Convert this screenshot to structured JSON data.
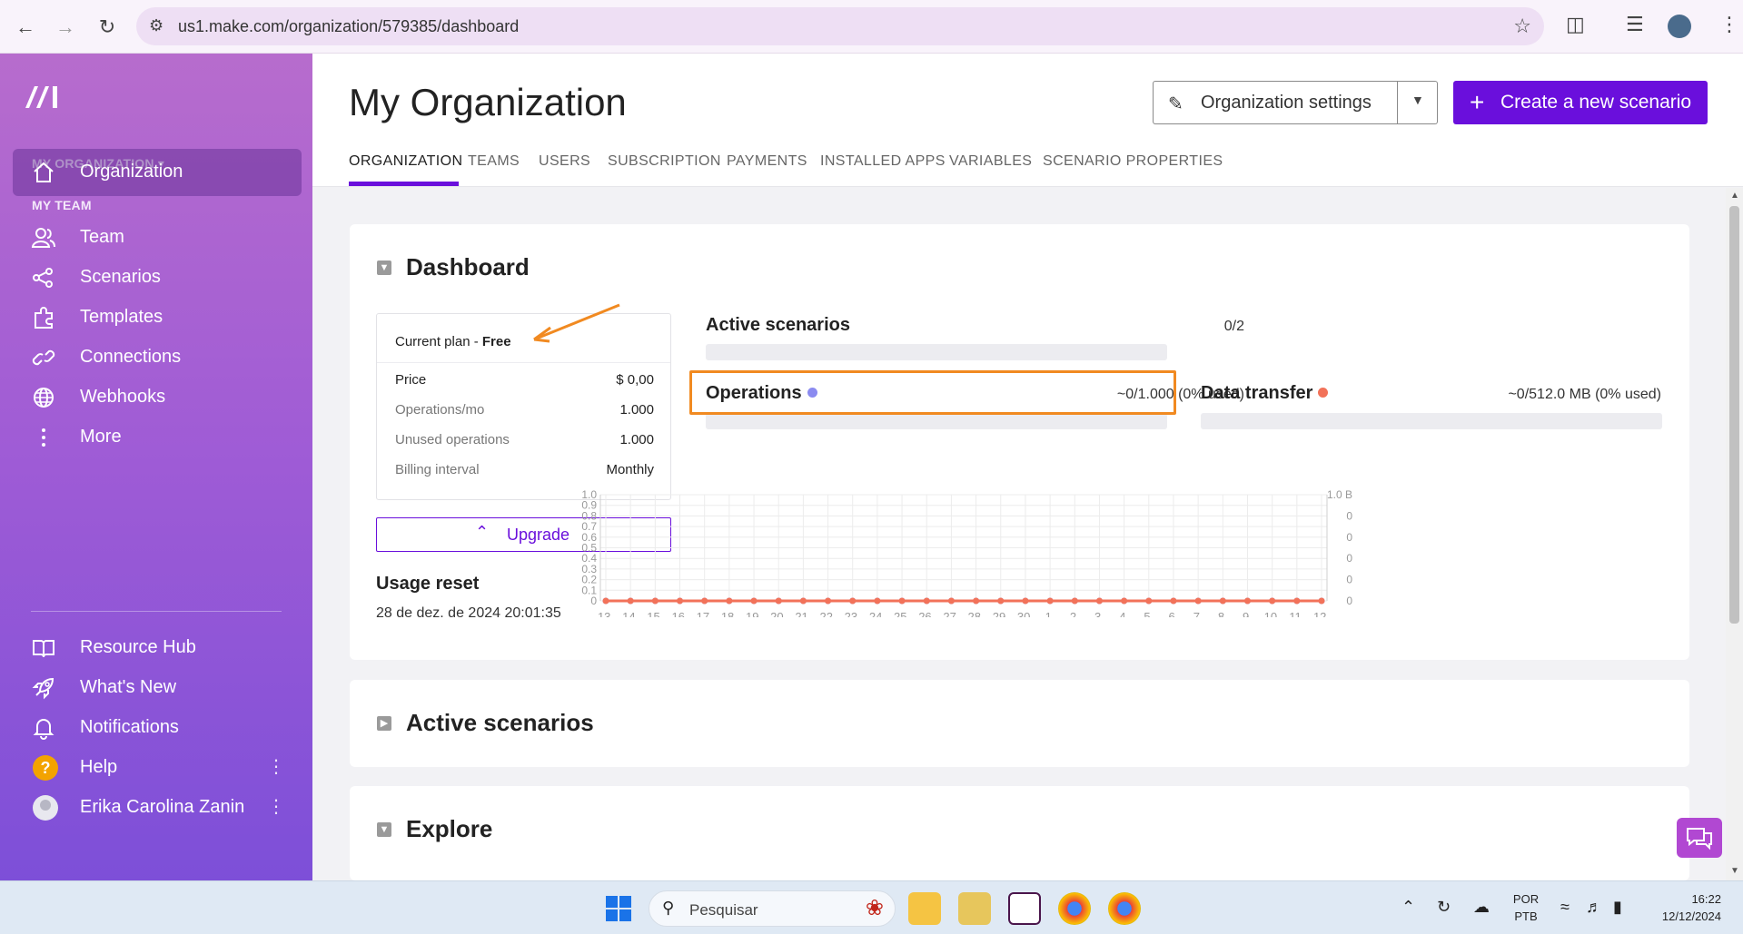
{
  "browser": {
    "url": "us1.make.com/organization/579385/dashboard"
  },
  "sidebar": {
    "org_label": "MY ORGANIZATION",
    "team_label": "MY TEAM",
    "items": [
      {
        "label": "Organization",
        "icon": "home-icon"
      },
      {
        "label": "Team",
        "icon": "users-icon"
      },
      {
        "label": "Scenarios",
        "icon": "share-nodes-icon"
      },
      {
        "label": "Templates",
        "icon": "puzzle-icon"
      },
      {
        "label": "Connections",
        "icon": "link-icon"
      },
      {
        "label": "Webhooks",
        "icon": "globe-icon"
      },
      {
        "label": "More",
        "icon": "more-vertical-icon"
      },
      {
        "label": "Resource Hub",
        "icon": "book-icon"
      },
      {
        "label": "What's New",
        "icon": "rocket-icon"
      },
      {
        "label": "Notifications",
        "icon": "bell-icon"
      },
      {
        "label": "Help",
        "icon": "help-icon"
      },
      {
        "label": "Erika Carolina Zanin",
        "icon": "avatar"
      }
    ]
  },
  "header": {
    "title": "My Organization",
    "settings_label": "Organization settings",
    "create_label": "Create a new scenario",
    "tabs": [
      "ORGANIZATION",
      "TEAMS",
      "USERS",
      "SUBSCRIPTION",
      "PAYMENTS",
      "INSTALLED APPS",
      "VARIABLES",
      "SCENARIO PROPERTIES"
    ]
  },
  "dashboard": {
    "title": "Dashboard",
    "plan": {
      "current_prefix": "Current plan - ",
      "current_name": "Free",
      "rows": [
        {
          "key": "Price",
          "value": "$ 0,00"
        },
        {
          "key": "Operations/mo",
          "value": "1.000"
        },
        {
          "key": "Unused operations",
          "value": "1.000"
        },
        {
          "key": "Billing interval",
          "value": "Monthly"
        }
      ]
    },
    "upgrade_label": "Upgrade",
    "usage_reset_title": "Usage reset",
    "usage_reset_value": "28 de dez. de 2024 20:01:35",
    "active_scenarios": {
      "label": "Active scenarios",
      "value": "0/2",
      "fraction": 0
    },
    "operations": {
      "label": "Operations",
      "value": "~0/1.000 (0% used)",
      "fraction": 0,
      "color": "#8b8bf0"
    },
    "data_transfer": {
      "label": "Data transfer",
      "value": "~0/512.0 MB (0% used)",
      "fraction": 0,
      "color": "#f27259"
    }
  },
  "chart_data": {
    "type": "line",
    "x": [
      "13.",
      "14.",
      "15.",
      "16.",
      "17.",
      "18.",
      "19.",
      "20.",
      "21.",
      "22.",
      "23.",
      "24.",
      "25.",
      "26.",
      "27.",
      "28.",
      "29.",
      "30.",
      "1.",
      "2.",
      "3.",
      "4.",
      "5.",
      "6.",
      "7.",
      "8.",
      "9.",
      "10.",
      "11.",
      "12."
    ],
    "y_left_ticks": [
      "0",
      "0.1",
      "0.2",
      "0.3",
      "0.4",
      "0.5",
      "0.6",
      "0.7",
      "0.8",
      "0.9",
      "1.0"
    ],
    "y_right_ticks": [
      "0",
      "0",
      "0",
      "0",
      "0",
      "1.0 B"
    ],
    "ylim": [
      0,
      1
    ],
    "grid": true,
    "series": [
      {
        "values": [
          0,
          0,
          0,
          0,
          0,
          0,
          0,
          0,
          0,
          0,
          0,
          0,
          0,
          0,
          0,
          0,
          0,
          0,
          0,
          0,
          0,
          0,
          0,
          0,
          0,
          0,
          0,
          0,
          0,
          0
        ],
        "color": "#8b8bf0"
      },
      {
        "values": [
          0,
          0,
          0,
          0,
          0,
          0,
          0,
          0,
          0,
          0,
          0,
          0,
          0,
          0,
          0,
          0,
          0,
          0,
          0,
          0,
          0,
          0,
          0,
          0,
          0,
          0,
          0,
          0,
          0,
          0
        ],
        "color": "#f27259"
      }
    ]
  },
  "sections": [
    {
      "title": "Active scenarios"
    },
    {
      "title": "Explore"
    }
  ],
  "taskbar": {
    "search_label": "Pesquisar",
    "lang_top": "POR",
    "lang_bottom": "PTB",
    "time": "16:22",
    "date": "12/12/2024"
  }
}
